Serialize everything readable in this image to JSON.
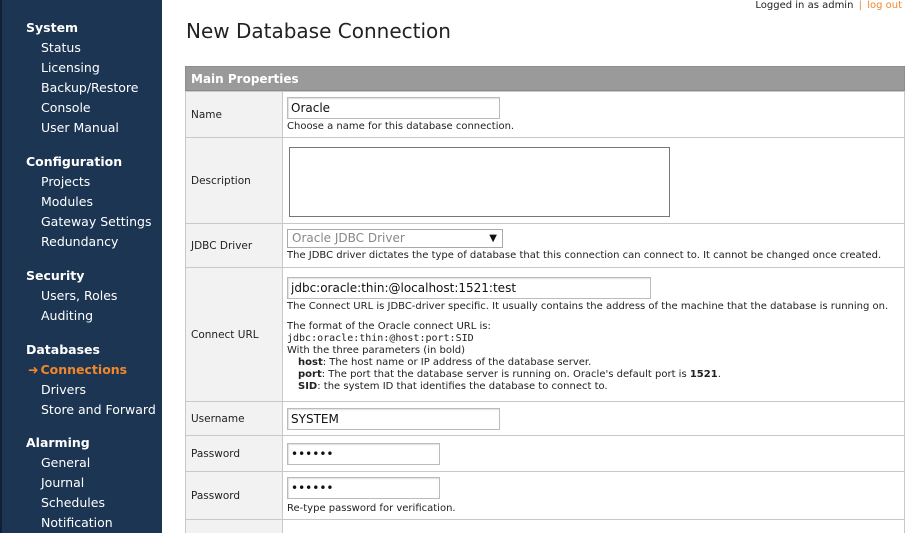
{
  "header": {
    "logged_in_text": "Logged in as admin",
    "separator": "|",
    "logout_label": "log out",
    "page_title": "New Database Connection"
  },
  "sidebar": {
    "sections": [
      {
        "title": "System",
        "items": [
          "Status",
          "Licensing",
          "Backup/Restore",
          "Console",
          "User Manual"
        ]
      },
      {
        "title": "Configuration",
        "items": [
          "Projects",
          "Modules",
          "Gateway Settings",
          "Redundancy"
        ]
      },
      {
        "title": "Security",
        "items": [
          "Users, Roles",
          "Auditing"
        ]
      },
      {
        "title": "Databases",
        "items": [
          "Connections",
          "Drivers",
          "Store and Forward"
        ]
      },
      {
        "title": "Alarming",
        "items": [
          "General",
          "Journal",
          "Schedules",
          "Notification"
        ]
      }
    ],
    "active_item": "Connections",
    "active_arrow": "➜"
  },
  "panel": {
    "title": "Main Properties",
    "name": {
      "label": "Name",
      "value": "Oracle",
      "help": "Choose a name for this database connection."
    },
    "description": {
      "label": "Description",
      "value": ""
    },
    "jdbc_driver": {
      "label": "JDBC Driver",
      "selected": "Oracle JDBC Driver",
      "help": "The JDBC driver dictates the type of database that this connection can connect to. It cannot be changed once created."
    },
    "connect_url": {
      "label": "Connect URL",
      "value": "jdbc:oracle:thin:@localhost:1521:test",
      "help1": "The Connect URL is JDBC-driver specific. It usually contains the address of the machine that the database is running on.",
      "format_intro": "The format of the Oracle connect URL is:",
      "format": "jdbc:oracle:thin:@host:port:SID",
      "params_intro": "With the three parameters (in bold)",
      "params": [
        {
          "name": "host",
          "desc": ": The host name or IP address of the database server."
        },
        {
          "name": "port",
          "desc": ": The port that the database server is running on. Oracle's default port is ",
          "extra": "1521",
          "tail": "."
        },
        {
          "name": "SID",
          "desc": ": the system ID that identifies the database to connect to."
        }
      ]
    },
    "username": {
      "label": "Username",
      "value": "SYSTEM"
    },
    "password": {
      "label": "Password",
      "value": "••••••"
    },
    "password_confirm": {
      "label": "Password",
      "value": "••••••",
      "help": "Re-type password for verification."
    }
  }
}
